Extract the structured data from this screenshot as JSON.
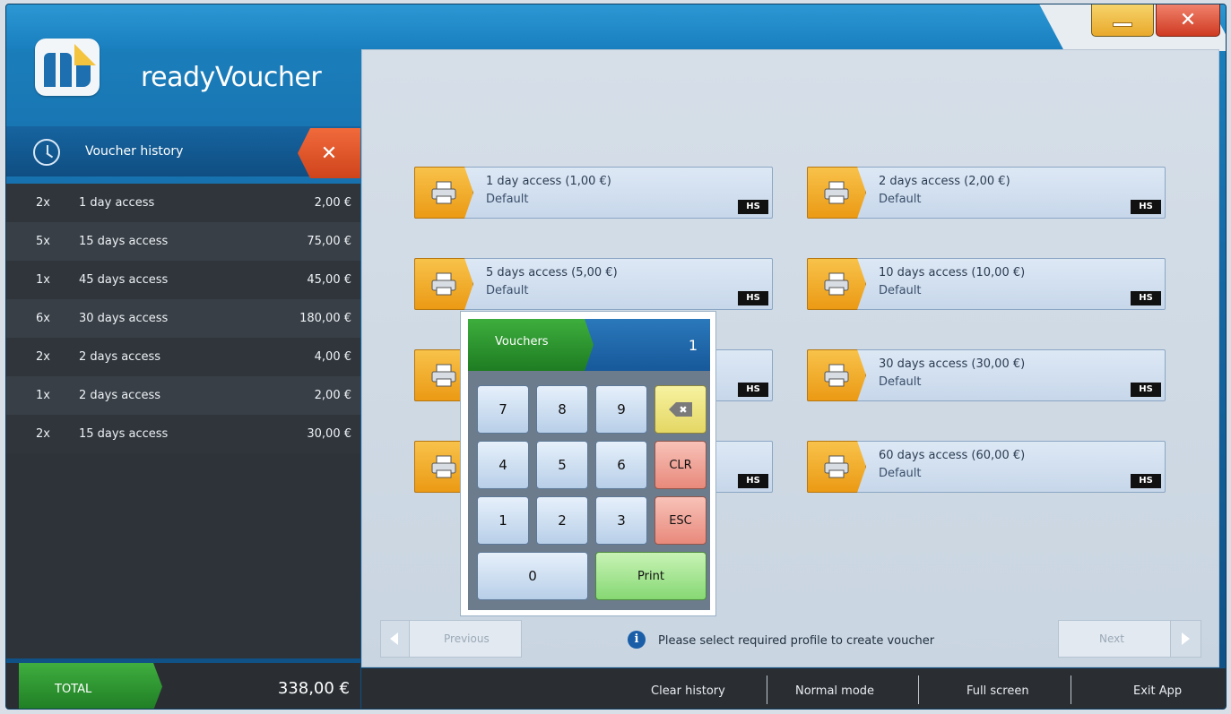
{
  "app": {
    "name": "readyVoucher"
  },
  "history": {
    "title": "Voucher history",
    "clear_icon": "close-icon",
    "rows": [
      {
        "qty": "2x",
        "name": "1 day access",
        "price": "2,00 €"
      },
      {
        "qty": "5x",
        "name": "15 days access",
        "price": "75,00 €"
      },
      {
        "qty": "1x",
        "name": "45 days access",
        "price": "45,00 €"
      },
      {
        "qty": "6x",
        "name": "30 days access",
        "price": "180,00 €"
      },
      {
        "qty": "2x",
        "name": "2 days access",
        "price": "4,00 €"
      },
      {
        "qty": "1x",
        "name": "2 days access",
        "price": "2,00 €"
      },
      {
        "qty": "2x",
        "name": "15 days access",
        "price": "30,00 €"
      }
    ]
  },
  "total": {
    "label": "TOTAL",
    "value": "338,00 €"
  },
  "profiles": [
    {
      "title": "1 day access (1,00 €)",
      "subtitle": "Default",
      "badge": "HS"
    },
    {
      "title": "2 days access (2,00 €)",
      "subtitle": "Default",
      "badge": "HS"
    },
    {
      "title": "5 days access (5,00 €)",
      "subtitle": "Default",
      "badge": "HS"
    },
    {
      "title": "10 days access (10,00 €)",
      "subtitle": "Default",
      "badge": "HS"
    },
    {
      "title": "",
      "subtitle": "",
      "badge": "HS"
    },
    {
      "title": "30 days access (30,00 €)",
      "subtitle": "Default",
      "badge": "HS"
    },
    {
      "title": "",
      "subtitle": "",
      "badge": "HS"
    },
    {
      "title": "60 days access (60,00 €)",
      "subtitle": "Default",
      "badge": "HS"
    }
  ],
  "keypad": {
    "label": "Vouchers",
    "count": "1",
    "keys": {
      "k7": "7",
      "k8": "8",
      "k9": "9",
      "k4": "4",
      "k5": "5",
      "k6": "6",
      "k1": "1",
      "k2": "2",
      "k3": "3",
      "k0": "0",
      "clr": "CLR",
      "esc": "ESC",
      "print": "Print",
      "backspace_glyph": "✖"
    }
  },
  "nav": {
    "previous": "Previous",
    "next": "Next",
    "info": "Please select required profile to create voucher"
  },
  "bottom": {
    "clear_history": "Clear history",
    "normal_mode": "Normal mode",
    "full_screen": "Full screen",
    "exit_app": "Exit App"
  },
  "window": {
    "close_glyph": "✕"
  },
  "colors": {
    "accent_blue": "#1a7fbf",
    "orange": "#eb9a14",
    "green": "#2a9a2f",
    "close_red": "#d0441b"
  }
}
